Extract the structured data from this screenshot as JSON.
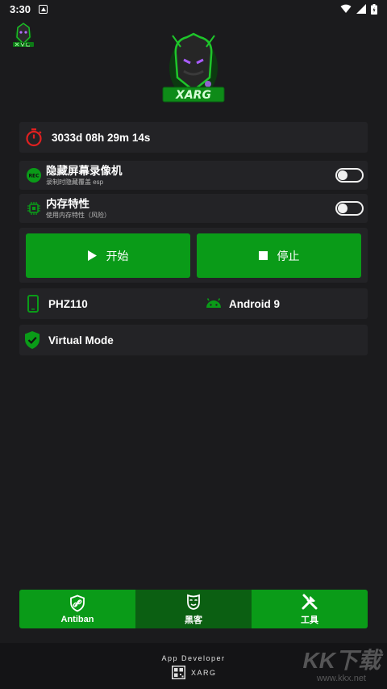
{
  "status_bar": {
    "time": "3:30"
  },
  "app": {
    "logo_text": "XARG"
  },
  "timer": {
    "value": "3033d 08h 29m 14s"
  },
  "toggles": [
    {
      "title": "隐藏屏幕录像机",
      "subtitle": "录制时隐藏覆盖 esp",
      "on": false
    },
    {
      "title": "内存特性",
      "subtitle": "使用内存特性（风险）",
      "on": false
    }
  ],
  "actions": {
    "start_label": "开始",
    "stop_label": "停止"
  },
  "device": {
    "model": "PHZ110",
    "android_version": "Android 9"
  },
  "mode": {
    "label": "Virtual Mode"
  },
  "bottom_nav": [
    {
      "label": "Antiban",
      "icon": "shield-link-icon",
      "active": false
    },
    {
      "label": "黑客",
      "icon": "mask-icon",
      "active": true
    },
    {
      "label": "工具",
      "icon": "tools-icon",
      "active": false
    }
  ],
  "footer": {
    "developer_label": "App Developer",
    "developer_name": "XARG",
    "watermark": "KK下载",
    "watermark_url": "www.kkx.net"
  },
  "colors": {
    "accent": "#0a9b18",
    "accent_dark": "#0b5f12",
    "background": "#1b1b1d",
    "card": "#232326",
    "danger": "#e02020"
  }
}
